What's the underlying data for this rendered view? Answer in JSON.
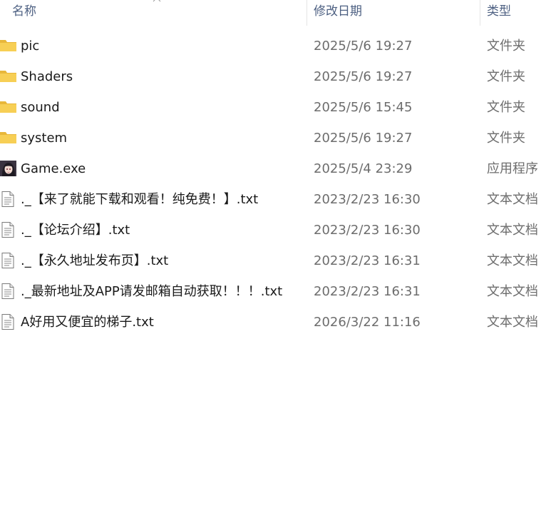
{
  "header": {
    "name_label": "名称",
    "date_label": "修改日期",
    "type_label": "类型"
  },
  "colors": {
    "header_text": "#4d6082",
    "name_text": "#1a1a1a",
    "meta_text": "#6d6d6d",
    "folder": "#f5c542"
  },
  "files": [
    {
      "name": "pic",
      "date": "2025/5/6 19:27",
      "type": "文件夹",
      "icon": "folder-icon"
    },
    {
      "name": "Shaders",
      "date": "2025/5/6 19:27",
      "type": "文件夹",
      "icon": "folder-icon"
    },
    {
      "name": "sound",
      "date": "2025/5/6 15:45",
      "type": "文件夹",
      "icon": "folder-icon"
    },
    {
      "name": "system",
      "date": "2025/5/6 19:27",
      "type": "文件夹",
      "icon": "folder-icon"
    },
    {
      "name": "Game.exe",
      "date": "2025/5/4 23:29",
      "type": "应用程序",
      "icon": "game-exe-icon"
    },
    {
      "name": "._【来了就能下载和观看！纯免费！】.txt",
      "date": "2023/2/23 16:30",
      "type": "文本文档",
      "icon": "text-file-icon"
    },
    {
      "name": "._【论坛介绍】.txt",
      "date": "2023/2/23 16:30",
      "type": "文本文档",
      "icon": "text-file-icon"
    },
    {
      "name": "._【永久地址发布页】.txt",
      "date": "2023/2/23 16:31",
      "type": "文本文档",
      "icon": "text-file-icon"
    },
    {
      "name": "._最新地址及APP请发邮箱自动获取！！！.txt",
      "date": "2023/2/23 16:31",
      "type": "文本文档",
      "icon": "text-file-icon"
    },
    {
      "name": "A好用又便宜的梯子.txt",
      "date": "2026/3/22 11:16",
      "type": "文本文档",
      "icon": "text-file-icon"
    }
  ]
}
